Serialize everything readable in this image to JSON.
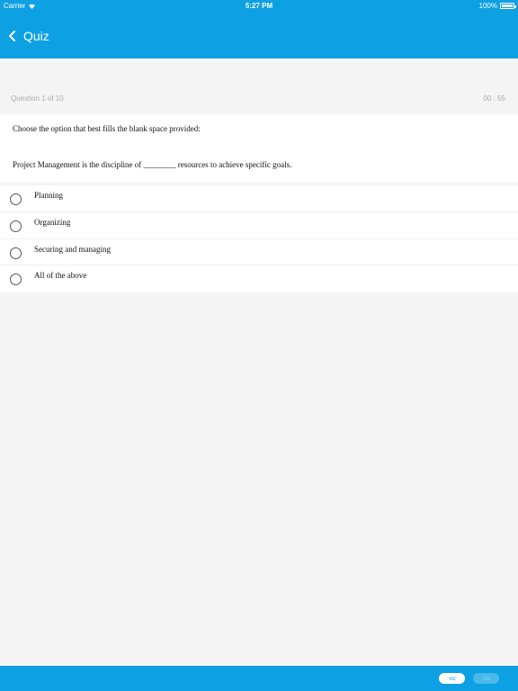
{
  "status": {
    "carrier": "Carrier",
    "time": "5:27 PM",
    "battery": "100%"
  },
  "nav": {
    "back_label": "Quiz"
  },
  "quiz": {
    "progress": "Question 1 of 10",
    "timer": "00 : 55",
    "instruction": "Choose the option that best fills the blank space provided:",
    "question": "Project Management is the discipline of ________ resources to achieve specific goals.",
    "options": [
      {
        "label": "Planning"
      },
      {
        "label": "Organizing"
      },
      {
        "label": "Securing and managing"
      },
      {
        "label": "All of the above"
      }
    ]
  },
  "footer": {
    "prev_label": "<<",
    "next_label": ">>"
  },
  "colors": {
    "accent": "#0da0e2",
    "background": "#f4f4f4"
  }
}
